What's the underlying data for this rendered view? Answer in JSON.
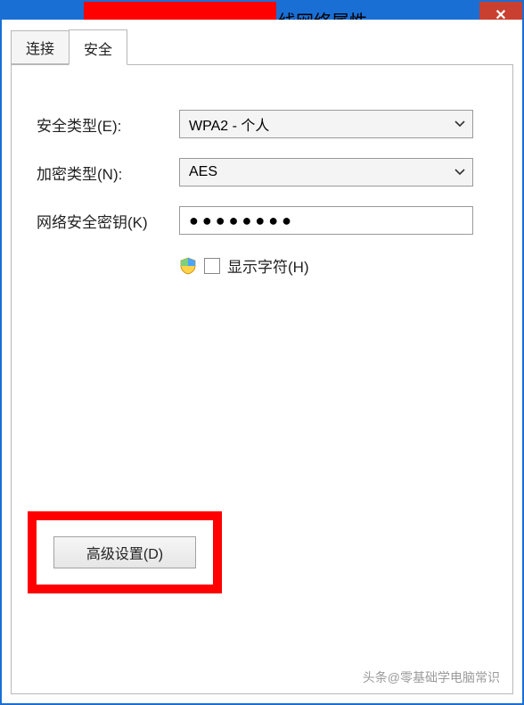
{
  "window": {
    "title_suffix": "线网络属性"
  },
  "tabs": {
    "connect": "连接",
    "security": "安全"
  },
  "form": {
    "security_type_label": "安全类型(E):",
    "security_type_value": "WPA2 - 个人",
    "encryption_label": "加密类型(N):",
    "encryption_value": "AES",
    "key_label": "网络安全密钥(K)",
    "key_value": "●●●●●●●●",
    "show_chars_label": "显示字符(H)"
  },
  "buttons": {
    "advanced": "高级设置(D)"
  },
  "watermark": "头条@零基础学电脑常识"
}
